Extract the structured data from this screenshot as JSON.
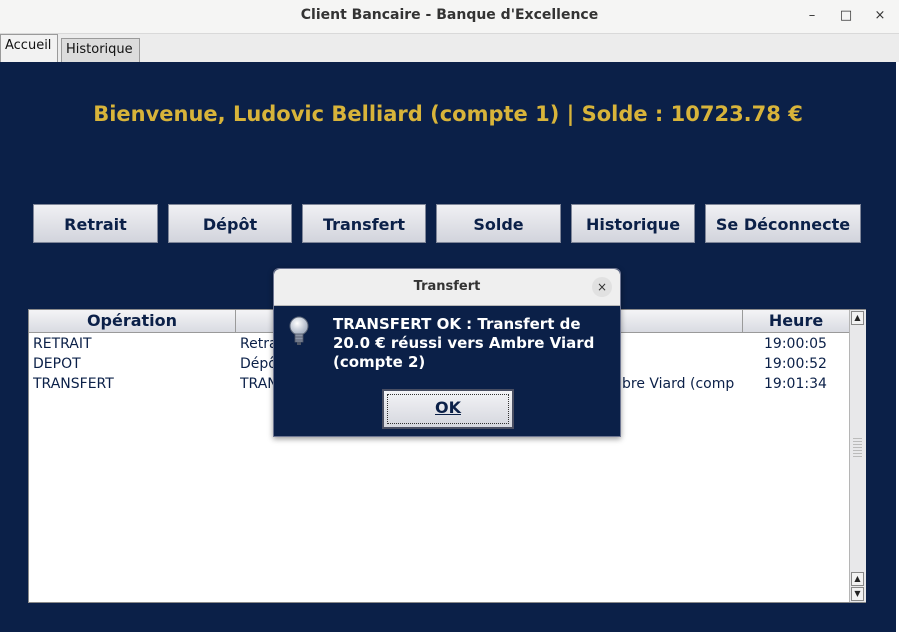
{
  "window": {
    "title": "Client Bancaire - Banque d'Excellence",
    "controls": {
      "minimize": "–",
      "maximize": "□",
      "close": "×"
    }
  },
  "tabs": [
    {
      "label": "Accueil",
      "active": true
    },
    {
      "label": "Historique",
      "active": false
    }
  ],
  "home": {
    "welcome": "Bienvenue, Ludovic Belliard (compte 1) | Solde : 10723.78 €",
    "buttons": [
      "Retrait",
      "Dépôt",
      "Transfert",
      "Solde",
      "Historique",
      "Se Déconnecte"
    ]
  },
  "table": {
    "columns": [
      "Opération",
      "",
      "",
      "Heure"
    ],
    "rows": [
      {
        "operation": "RETRAIT",
        "detail": "Retra",
        "extra": "",
        "time": "19:00:05"
      },
      {
        "operation": "DEPOT",
        "detail": "Dépô",
        "extra": "",
        "time": "19:00:52"
      },
      {
        "operation": "TRANSFERT",
        "detail": "TRAN",
        "extra": "bre Viard (comp",
        "time": "19:01:34"
      }
    ]
  },
  "dialog": {
    "title": "Transfert",
    "close": "×",
    "message": "TRANSFERT OK : Transfert de 20.0 € réussi vers Ambre Viard (compte 2)",
    "ok": "OK",
    "icon": "lightbulb-icon"
  },
  "colors": {
    "panel_bg": "#0b2048",
    "accent_gold": "#d8b43a",
    "text_navy": "#0b2048"
  }
}
